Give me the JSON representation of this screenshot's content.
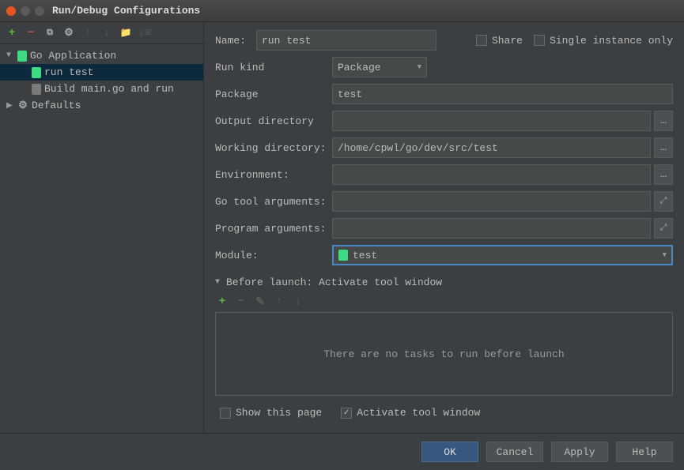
{
  "window": {
    "title": "Run/Debug Configurations"
  },
  "tree": {
    "root": {
      "label": "Go Application"
    },
    "items": [
      {
        "label": "run test",
        "selected": true
      },
      {
        "label": "Build main.go and run",
        "selected": false
      }
    ],
    "defaults": {
      "label": "Defaults"
    }
  },
  "form": {
    "name": {
      "label": "Name:",
      "value": "run test"
    },
    "share": {
      "label": "Share",
      "checked": false
    },
    "single": {
      "label": "Single instance only",
      "checked": false
    },
    "run_kind": {
      "label": "Run kind",
      "value": "Package"
    },
    "package": {
      "label": "Package",
      "value": "test"
    },
    "output_dir": {
      "label": "Output directory",
      "value": ""
    },
    "working_dir": {
      "label": "Working directory:",
      "value": "/home/cpwl/go/dev/src/test"
    },
    "environment": {
      "label": "Environment:",
      "value": ""
    },
    "go_tool_args": {
      "label": "Go tool arguments:",
      "value": ""
    },
    "program_args": {
      "label": "Program arguments:",
      "value": ""
    },
    "module": {
      "label": "Module:",
      "value": "test"
    }
  },
  "before_launch": {
    "title": "Before launch: Activate tool window",
    "empty": "There are no tasks to run before launch"
  },
  "show_page": {
    "label": "Show this page",
    "checked": false
  },
  "activate_tool": {
    "label": "Activate tool window",
    "checked": true
  },
  "buttons": {
    "ok": "OK",
    "cancel": "Cancel",
    "apply": "Apply",
    "help": "Help"
  }
}
